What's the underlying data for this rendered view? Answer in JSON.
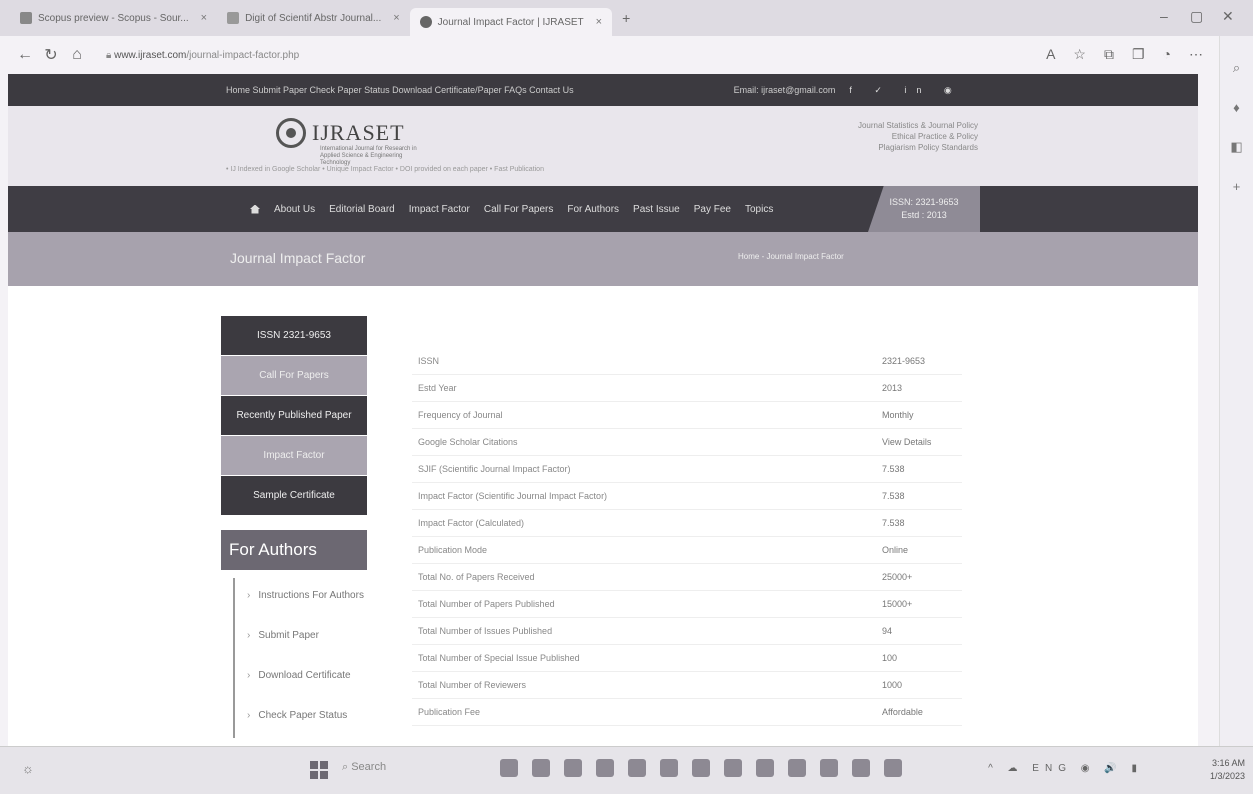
{
  "browser": {
    "tabs": [
      {
        "label": "Scopus preview - Scopus - Sour..."
      },
      {
        "label": "Digit of Scientif Abstr Journal..."
      },
      {
        "label": "Journal Impact Factor | IJRASET",
        "active": true
      }
    ],
    "new_tab": "+",
    "url_domain": "www.ijraset.com",
    "url_path": "/journal-impact-factor.php",
    "window_controls": [
      "–",
      "▢",
      "✕"
    ]
  },
  "site": {
    "top_links": "Home  Submit Paper  Check Paper Status  Download Certificate/Paper  FAQs  Contact Us",
    "email": "Email: ijraset@gmail.com",
    "social": "f  ✓  in  ◉",
    "logo_text": "IJRASET",
    "logo_sub": "International Journal for Research in Applied Science & Engineering Technology",
    "header_right": [
      "Journal Statistics & Journal Policy",
      "Ethical Practice & Policy",
      "Plagiarism Policy Standards"
    ],
    "header_bottom": "• IJ Indexed in Google Scholar   • Unique Impact Factor   • DOI provided on each paper   • Fast Publication",
    "nav": [
      "About Us",
      "Editorial Board",
      "Impact Factor",
      "Call For Papers",
      "For Authors",
      "Past Issue",
      "Pay Fee",
      "Topics"
    ],
    "issn_line1": "ISSN: 2321-9653",
    "issn_line2": "Estd : 2013",
    "banner_title": "Journal Impact Factor",
    "breadcrumb": "Home - Journal Impact Factor"
  },
  "leftmenu": {
    "items": [
      "ISSN 2321-9653",
      "Call For Papers",
      "Recently Published Paper",
      "Impact Factor",
      "Sample Certificate"
    ],
    "authors_heading": "For Authors",
    "author_links": [
      "Instructions For Authors",
      "Submit Paper",
      "Download Certificate",
      "Check Paper Status"
    ]
  },
  "table": {
    "rows": [
      {
        "k": "ISSN",
        "v": "2321-9653"
      },
      {
        "k": "Estd Year",
        "v": "2013"
      },
      {
        "k": "Frequency of Journal",
        "v": "Monthly"
      },
      {
        "k": "Google Scholar Citations",
        "v": "View Details"
      },
      {
        "k": "SJIF (Scientific Journal Impact Factor)",
        "v": "7.538"
      },
      {
        "k": "Impact Factor (Scientific Journal Impact Factor)",
        "v": "7.538"
      },
      {
        "k": "Impact Factor (Calculated)",
        "v": "7.538"
      },
      {
        "k": "Publication Mode",
        "v": "Online"
      },
      {
        "k": "Total No. of Papers Received",
        "v": "25000+"
      },
      {
        "k": "Total Number of Papers Published",
        "v": "15000+"
      },
      {
        "k": "Total Number of Issues Published",
        "v": "94"
      },
      {
        "k": "Total Number of Special Issue Published",
        "v": "100"
      },
      {
        "k": "Total Number of Reviewers",
        "v": "1000"
      },
      {
        "k": "Publication Fee",
        "v": "Affordable"
      }
    ]
  },
  "taskbar": {
    "search": "Search",
    "tray": "^ ☁ ENG ◉ 🔊 ▮",
    "time": "3:16 AM",
    "date": "1/3/2023"
  }
}
